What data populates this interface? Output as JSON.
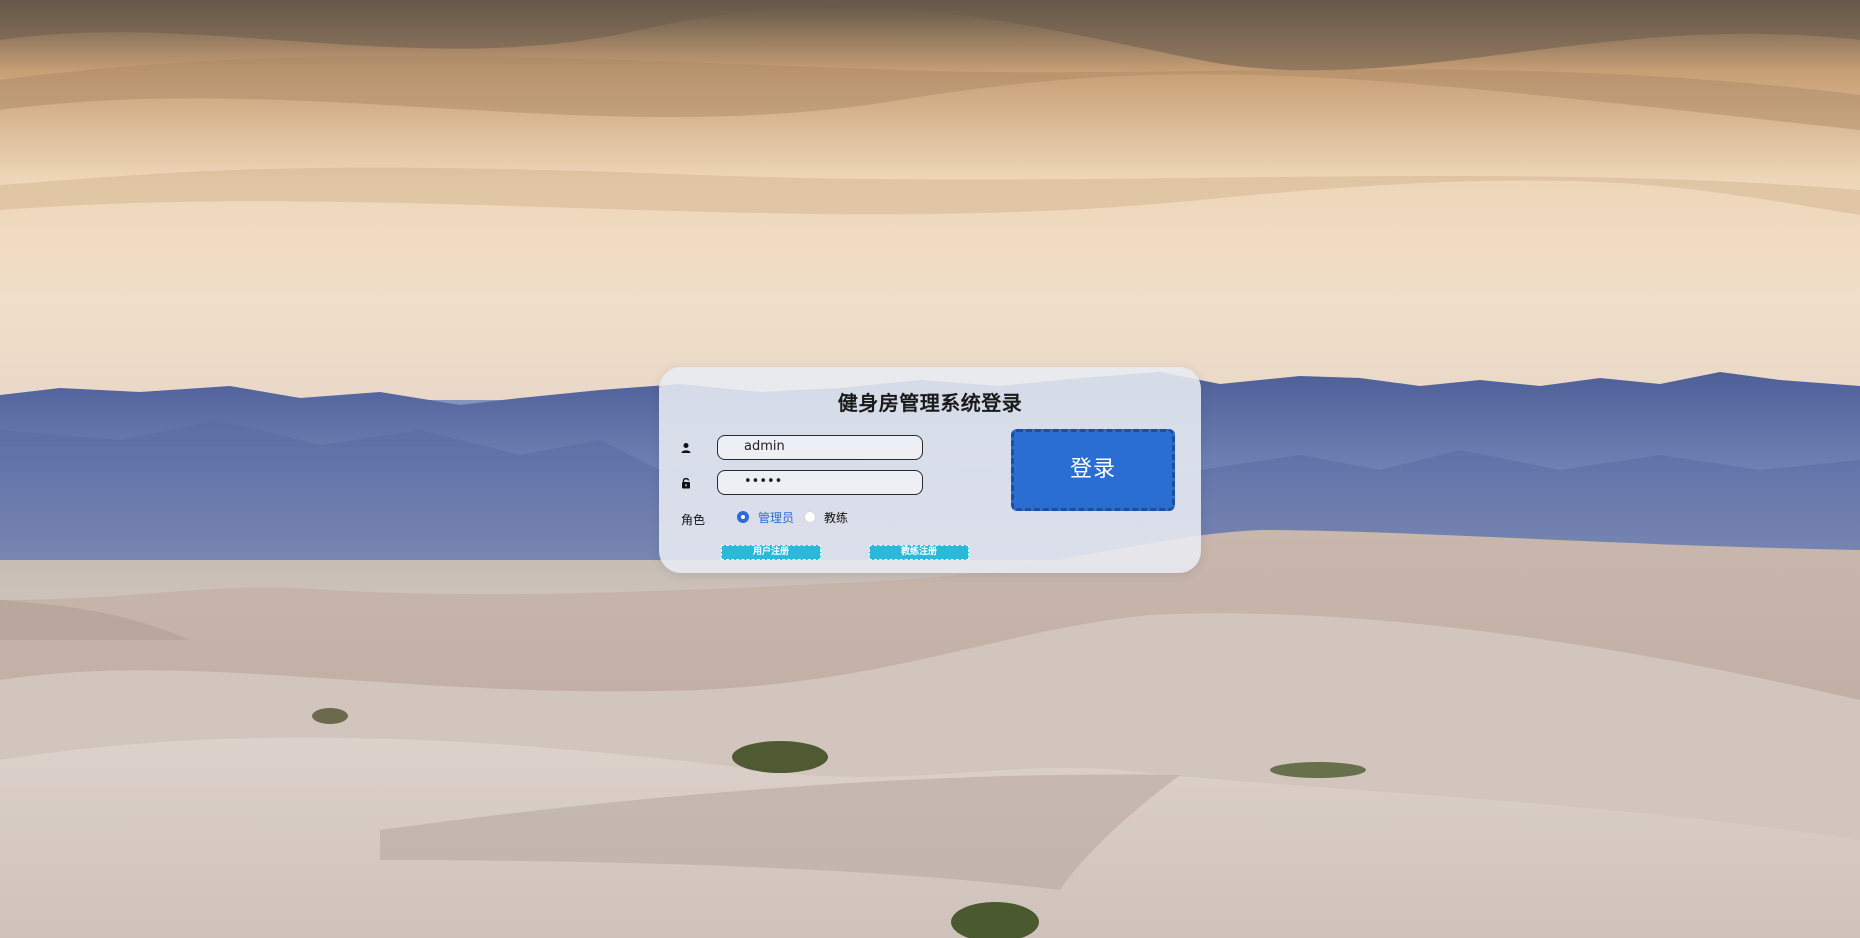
{
  "login": {
    "title": "健身房管理系统登录",
    "username_value": "admin",
    "password_value": "•••••",
    "role_label": "角色",
    "roles": [
      {
        "label": "管理员",
        "checked": true
      },
      {
        "label": "教练",
        "checked": false
      }
    ],
    "login_button": "登录",
    "user_register_button": "用户注册",
    "coach_register_button": "教练注册"
  },
  "icons": {
    "username": "user-icon",
    "password": "lock-icon"
  },
  "colors": {
    "accent": "#2b6ed3",
    "register": "#2bb9d9",
    "radio_checked": "#2f6bd8"
  }
}
